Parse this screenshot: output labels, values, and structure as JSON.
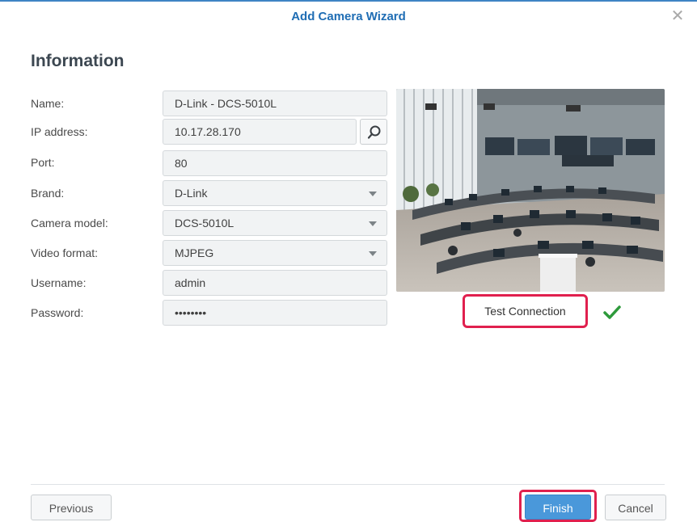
{
  "window": {
    "title": "Add Camera Wizard"
  },
  "section": {
    "heading": "Information"
  },
  "form": {
    "name_label": "Name:",
    "name_value": "D-Link - DCS-5010L",
    "ip_label": "IP address:",
    "ip_value": "10.17.28.170",
    "port_label": "Port:",
    "port_value": "80",
    "brand_label": "Brand:",
    "brand_value": "D-Link",
    "model_label": "Camera model:",
    "model_value": "DCS-5010L",
    "format_label": "Video format:",
    "format_value": "MJPEG",
    "username_label": "Username:",
    "username_value": "admin",
    "password_label": "Password:",
    "password_value": "••••••••"
  },
  "preview": {
    "test_label": "Test Connection",
    "status": "success"
  },
  "footer": {
    "previous_label": "Previous",
    "finish_label": "Finish",
    "cancel_label": "Cancel"
  },
  "icons": {
    "close": "close-icon",
    "search": "search-icon",
    "check": "check-icon",
    "dropdown": "chevron-down-icon"
  },
  "colors": {
    "accent": "#1f6db4",
    "primary_button": "#4a98da",
    "highlight": "#e0204e",
    "success": "#2e9a3b"
  }
}
